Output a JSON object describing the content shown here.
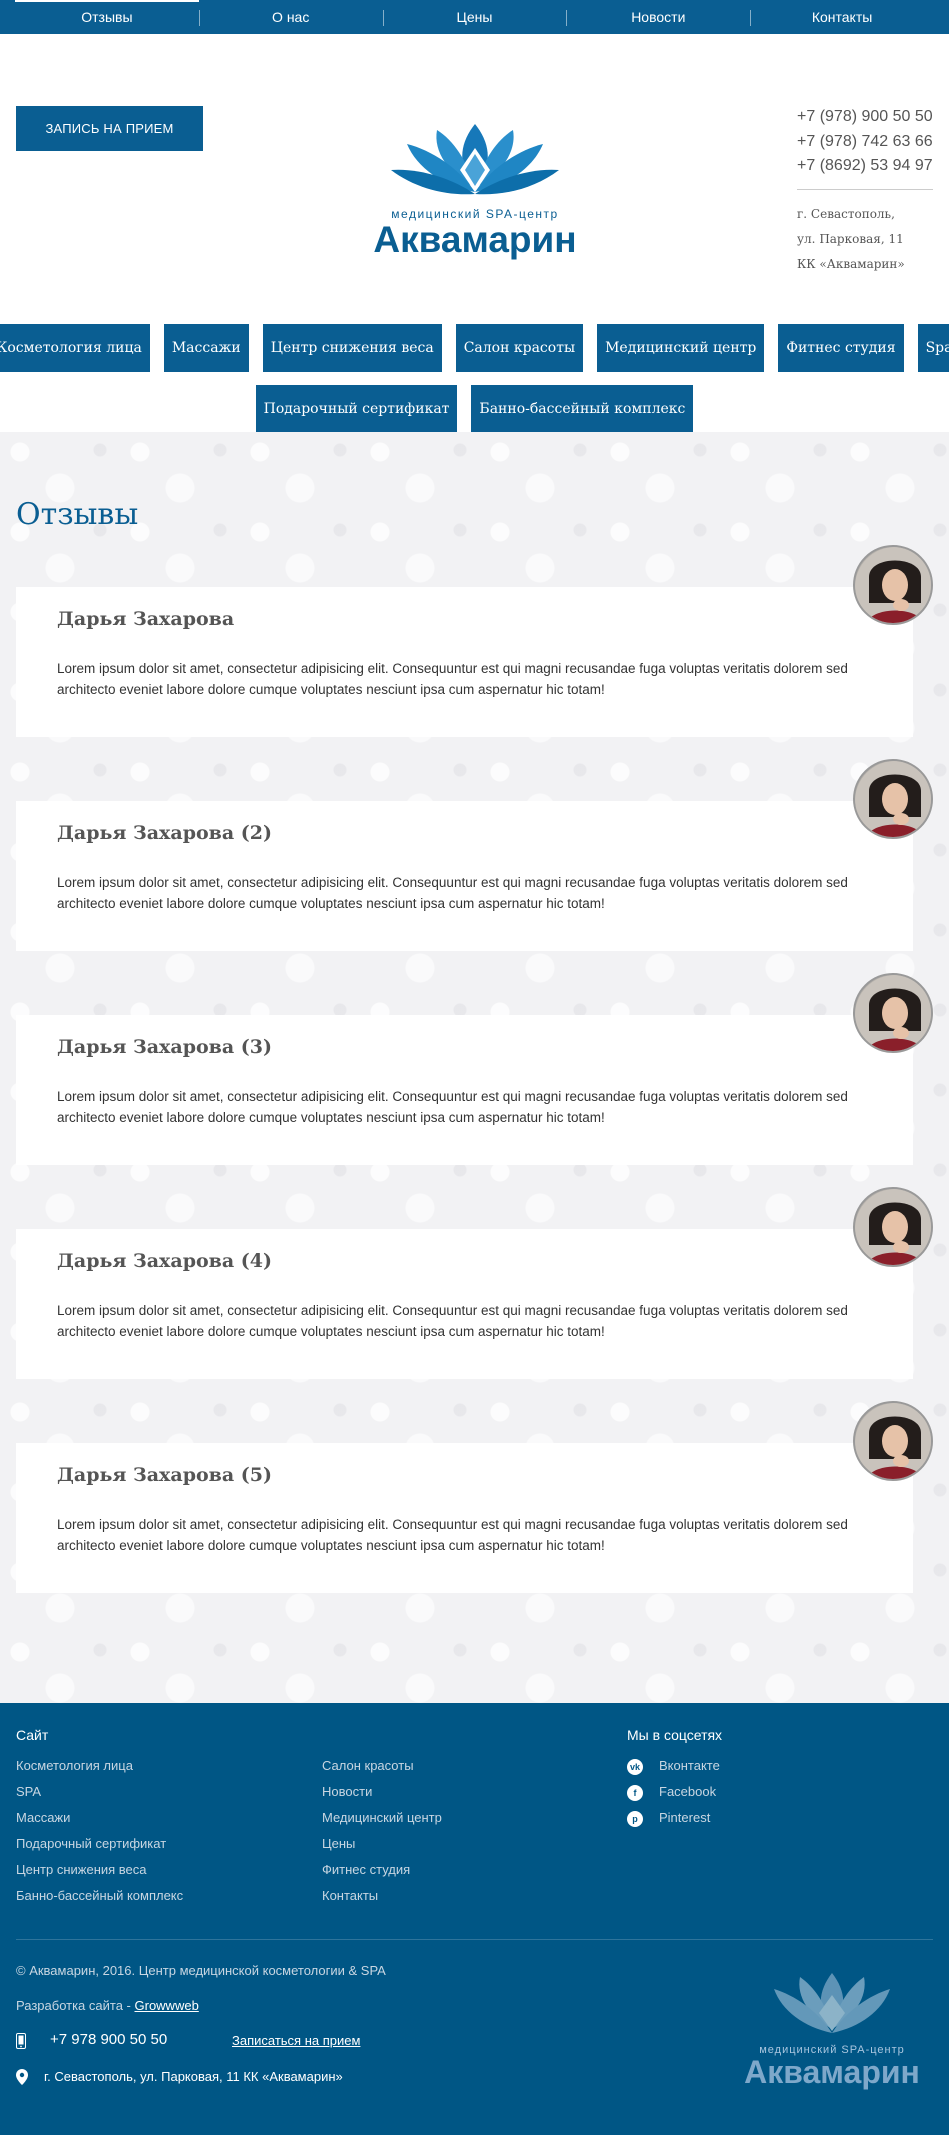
{
  "top_nav": [
    {
      "label": "Отзывы",
      "active": true
    },
    {
      "label": "О нас",
      "active": false
    },
    {
      "label": "Цены",
      "active": false
    },
    {
      "label": "Новости",
      "active": false
    },
    {
      "label": "Контакты",
      "active": false
    }
  ],
  "header": {
    "appointment_button": "ЗАПИСЬ НА ПРИЕМ",
    "logo": {
      "subtitle": "медицинский SPA-центр",
      "name": "Аквамарин"
    },
    "phones": [
      "+7 (978) 900 50 50",
      "+7 (978) 742 63 66",
      "+7 (8692) 53 94 97"
    ],
    "address": [
      "г. Севастополь,",
      "ул. Парковая, 11",
      "КК «Аквамарин»"
    ]
  },
  "services": {
    "row1": [
      "Косметология лица",
      "Массажи",
      "Центр снижения веса",
      "Салон красоты",
      "Медицинский центр",
      "Фитнес студия",
      "Spa"
    ],
    "row2": [
      "Подарочный сертификат",
      "Банно-бассейный комплекс"
    ]
  },
  "reviews": {
    "title": "Отзывы",
    "items": [
      {
        "name": "Дарья Захарова",
        "text": "Lorem ipsum dolor sit amet, consectetur adipisicing elit. Consequuntur est qui magni recusandae fuga voluptas veritatis dolorem sed architecto eveniet labore dolore cumque voluptates nesciunt ipsa cum aspernatur hic totam!"
      },
      {
        "name": "Дарья Захарова (2)",
        "text": "Lorem ipsum dolor sit amet, consectetur adipisicing elit. Consequuntur est qui magni recusandae fuga voluptas veritatis dolorem sed architecto eveniet labore dolore cumque voluptates nesciunt ipsa cum aspernatur hic totam!"
      },
      {
        "name": "Дарья Захарова (3)",
        "text": "Lorem ipsum dolor sit amet, consectetur adipisicing elit. Consequuntur est qui magni recusandae fuga voluptas veritatis dolorem sed architecto eveniet labore dolore cumque voluptates nesciunt ipsa cum aspernatur hic totam!"
      },
      {
        "name": "Дарья Захарова (4)",
        "text": "Lorem ipsum dolor sit amet, consectetur adipisicing elit. Consequuntur est qui magni recusandae fuga voluptas veritatis dolorem sed architecto eveniet labore dolore cumque voluptates nesciunt ipsa cum aspernatur hic totam!"
      },
      {
        "name": "Дарья Захарова (5)",
        "text": "Lorem ipsum dolor sit amet, consectetur adipisicing elit. Consequuntur est qui magni recusandae fuga voluptas veritatis dolorem sed architecto eveniet labore dolore cumque voluptates nesciunt ipsa cum aspernatur hic totam!"
      }
    ]
  },
  "footer": {
    "site_title": "Сайт",
    "site_links_col1": [
      "Косметология лица",
      "SPA",
      "Массажи",
      "Подарочный сертификат",
      "Центр снижения веса",
      "Банно-бассейный комплекс"
    ],
    "site_links_col2": [
      "Салон красоты",
      "Новости",
      "Медицинский центр",
      "Цены",
      "Фитнес студия",
      "Контакты"
    ],
    "social_title": "Мы в соцсетях",
    "social": [
      {
        "label": "Вконтакте",
        "icon": "vk-icon"
      },
      {
        "label": "Facebook",
        "icon": "facebook-icon"
      },
      {
        "label": "Pinterest",
        "icon": "pinterest-icon"
      }
    ],
    "copyright": "© Аквамарин, 2016. Центр медицинской косметологии & SPA",
    "developer_prefix": "Разработка сайта - ",
    "developer_link": "Growwweb",
    "phone": "+7 978 900 50 50",
    "appointment_link": "Записаться на прием",
    "address": "г. Севастополь, ул. Парковая, 11 КК «Аквамарин»"
  },
  "colors": {
    "brand_blue": "#0a5e92",
    "footer_blue": "#005685",
    "background": "#f2f2f4"
  }
}
